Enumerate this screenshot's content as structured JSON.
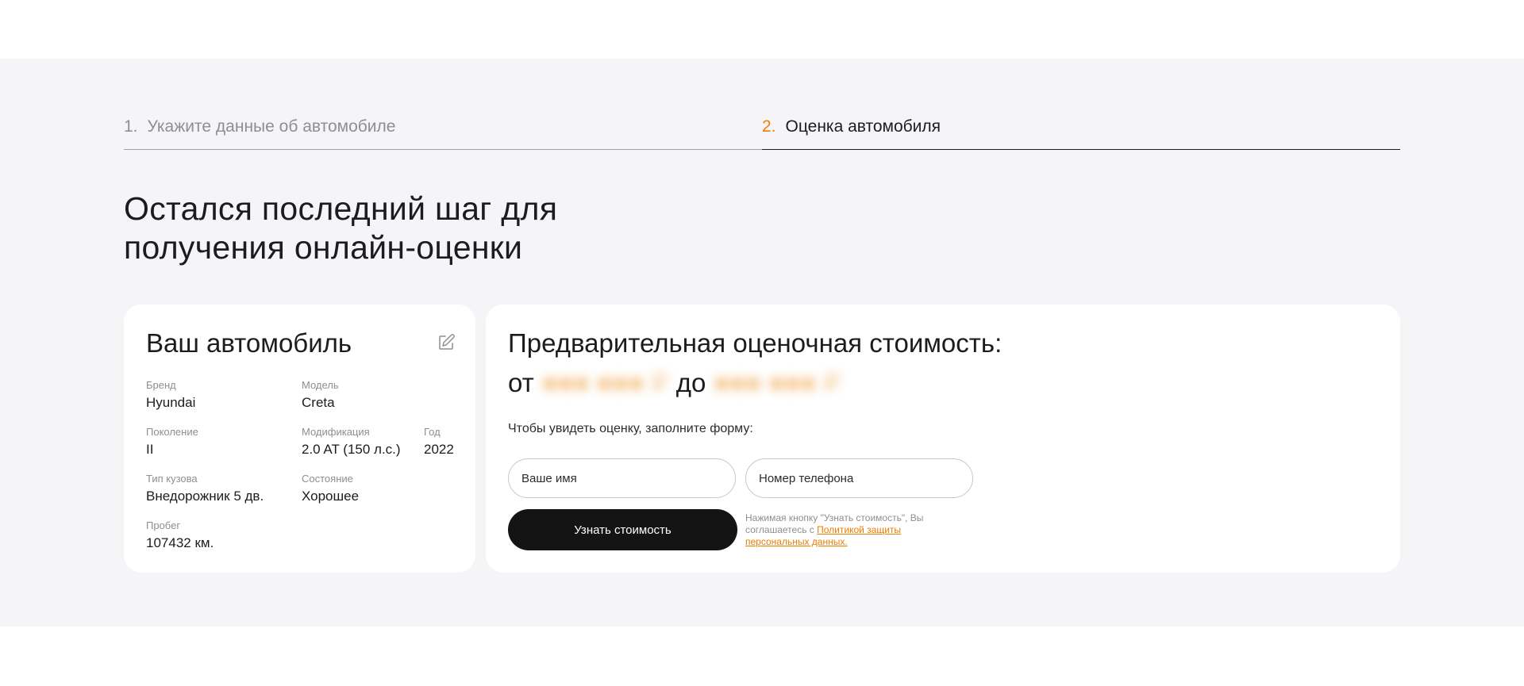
{
  "steps": [
    {
      "number": "1.",
      "label": "Укажите данные об автомобиле"
    },
    {
      "number": "2.",
      "label": "Оценка автомобиля"
    }
  ],
  "heading": {
    "line1": "Остался последний шаг для",
    "line2": "получения онлайн-оценки"
  },
  "car": {
    "title": "Ваш автомобиль",
    "edit_icon": "edit-icon",
    "fields": {
      "brand": {
        "label": "Бренд",
        "value": "Hyundai"
      },
      "model": {
        "label": "Модель",
        "value": "Creta"
      },
      "generation": {
        "label": "Поколение",
        "value": "II"
      },
      "modification": {
        "label": "Модификация",
        "value": "2.0 AT (150 л.с.)"
      },
      "year": {
        "label": "Год",
        "value": "2022"
      },
      "body": {
        "label": "Тип кузова",
        "value": "Внедорожник 5 дв."
      },
      "condition": {
        "label": "Состояние",
        "value": "Хорошее"
      },
      "mileage": {
        "label": "Пробег",
        "value": "107432 км."
      }
    }
  },
  "estimate": {
    "title": "Предварительная оценочная стоимость:",
    "from_label": "от",
    "to_label": "до",
    "hint": "Чтобы увидеть оценку, заполните форму:",
    "name_placeholder": "Ваше имя",
    "phone_placeholder": "Номер телефона",
    "submit_label": "Узнать стоимость",
    "consent_text": "Нажимая кнопку \"Узнать стоимость\", Вы соглашаетесь с ",
    "consent_link": "Политикой защиты персональных данных."
  },
  "colors": {
    "accent": "#f07c00",
    "background_band": "#f5f5f7",
    "button": "#141414"
  }
}
